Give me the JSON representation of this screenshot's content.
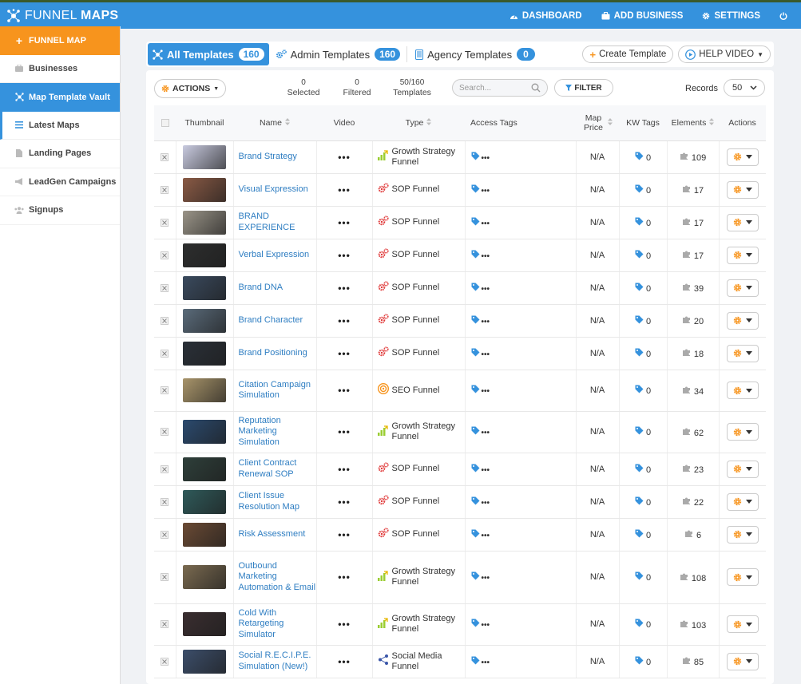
{
  "app": {
    "title_light": "FUNNEL ",
    "title_bold": "MAPS"
  },
  "topnav": [
    {
      "label": "DASHBOARD",
      "icon": "dashboard-icon"
    },
    {
      "label": "ADD BUSINESS",
      "icon": "briefcase-icon"
    },
    {
      "label": "SETTINGS",
      "icon": "gear-icon"
    }
  ],
  "sidebar": {
    "items": [
      {
        "label": "FUNNEL MAP"
      },
      {
        "label": "Businesses"
      },
      {
        "label": "Map Template Vault"
      },
      {
        "label": "Latest Maps"
      },
      {
        "label": "Landing Pages"
      },
      {
        "label": "LeadGen Campaigns"
      },
      {
        "label": "Signups"
      }
    ]
  },
  "tabs": [
    {
      "label": "All Templates",
      "count": "160"
    },
    {
      "label": "Admin Templates",
      "count": "160"
    },
    {
      "label": "Agency Templates",
      "count": "0"
    }
  ],
  "buttons": {
    "create": "Create Template",
    "help": "HELP VIDEO",
    "actions": "ACTIONS",
    "filter": "FILTER"
  },
  "stats": [
    {
      "value": "0",
      "label": "Selected"
    },
    {
      "value": "0",
      "label": "Filtered"
    },
    {
      "value": "50/160",
      "label": "Templates"
    }
  ],
  "search": {
    "placeholder": "Search..."
  },
  "records": {
    "label": "Records",
    "value": "50"
  },
  "table": {
    "headers": [
      "Thumbnail",
      "Name",
      "Video",
      "Type",
      "Access Tags",
      "Map Price",
      "KW Tags",
      "Elements",
      "Actions"
    ],
    "rows": [
      {
        "name": "Brand Strategy",
        "type": "Growth Strategy Funnel",
        "type_icon": "growth-icon",
        "price": "N/A",
        "kw": "0",
        "elements": "109",
        "thumb": "#c9cbe0"
      },
      {
        "name": "Visual Expression",
        "type": "SOP Funnel",
        "type_icon": "sop-icon",
        "price": "N/A",
        "kw": "0",
        "elements": "17",
        "thumb": "#8a5a45"
      },
      {
        "name": "BRAND EXPERIENCE",
        "type": "SOP Funnel",
        "type_icon": "sop-icon",
        "price": "N/A",
        "kw": "0",
        "elements": "17",
        "thumb": "#9a9488"
      },
      {
        "name": "Verbal Expression",
        "type": "SOP Funnel",
        "type_icon": "sop-icon",
        "price": "N/A",
        "kw": "0",
        "elements": "17",
        "thumb": "#2d2e2e"
      },
      {
        "name": "Brand DNA",
        "type": "SOP Funnel",
        "type_icon": "sop-icon",
        "price": "N/A",
        "kw": "0",
        "elements": "39",
        "thumb": "#3a4a5e"
      },
      {
        "name": "Brand Character",
        "type": "SOP Funnel",
        "type_icon": "sop-icon",
        "price": "N/A",
        "kw": "0",
        "elements": "20",
        "thumb": "#5a6b7a"
      },
      {
        "name": "Brand Positioning",
        "type": "SOP Funnel",
        "type_icon": "sop-icon",
        "price": "N/A",
        "kw": "0",
        "elements": "18",
        "thumb": "#2a3038"
      },
      {
        "name": "Citation Campaign Simulation",
        "type": "SEO Funnel",
        "type_icon": "seo-icon",
        "price": "N/A",
        "kw": "0",
        "elements": "34",
        "thumb": "#a8946a"
      },
      {
        "name": "Reputation Marketing Simulation",
        "type": "Growth Strategy Funnel",
        "type_icon": "growth-icon",
        "price": "N/A",
        "kw": "0",
        "elements": "62",
        "thumb": "#2b4a6e"
      },
      {
        "name": "Client Contract Renewal SOP",
        "type": "SOP Funnel",
        "type_icon": "sop-icon",
        "price": "N/A",
        "kw": "0",
        "elements": "23",
        "thumb": "#2e3f3a"
      },
      {
        "name": "Client Issue Resolution Map",
        "type": "SOP Funnel",
        "type_icon": "sop-icon",
        "price": "N/A",
        "kw": "0",
        "elements": "22",
        "thumb": "#2f5a5a"
      },
      {
        "name": "Risk Assessment",
        "type": "SOP Funnel",
        "type_icon": "sop-icon",
        "price": "N/A",
        "kw": "0",
        "elements": "6",
        "thumb": "#6a4a34"
      },
      {
        "name": "Outbound Marketing Automation & Email",
        "type": "Growth Strategy Funnel",
        "type_icon": "growth-icon",
        "price": "N/A",
        "kw": "0",
        "elements": "108",
        "thumb": "#7a6a50"
      },
      {
        "name": "Cold With Retargeting Simulator",
        "type": "Growth Strategy Funnel",
        "type_icon": "growth-icon",
        "price": "N/A",
        "kw": "0",
        "elements": "103",
        "thumb": "#3a2e30"
      },
      {
        "name": "Social R.E.C.I.P.E. Simulation (New!)",
        "type": "Social Media Funnel",
        "type_icon": "social-icon",
        "price": "N/A",
        "kw": "0",
        "elements": "85",
        "thumb": "#3c4e6a"
      }
    ]
  },
  "colors": {
    "primary": "#3592dd",
    "accent": "#f7941d",
    "link": "#2f7ec2"
  }
}
